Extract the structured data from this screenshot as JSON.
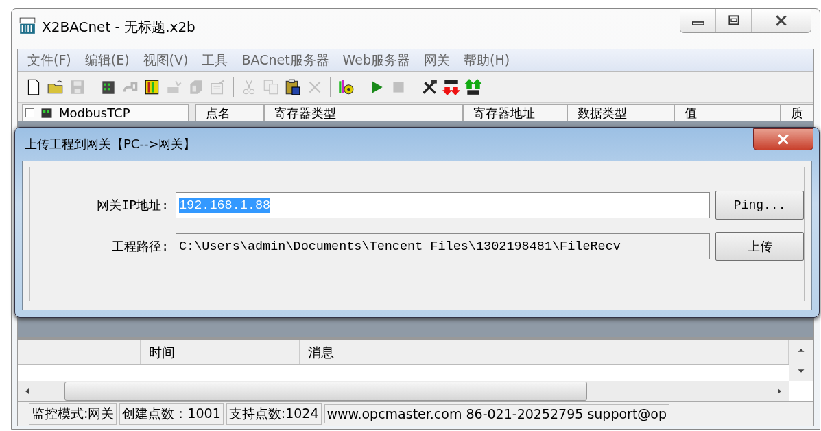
{
  "window": {
    "title": "X2BACnet - 无标题.x2b"
  },
  "menu": [
    "文件(F)",
    "编辑(E)",
    "视图(V)",
    "工具",
    "BACnet服务器",
    "Web服务器",
    "网关",
    "帮助(H)"
  ],
  "toolbar": [
    {
      "kind": "new",
      "disabled": false
    },
    {
      "kind": "open",
      "disabled": false
    },
    {
      "kind": "save",
      "disabled": true
    },
    {
      "kind": "sep"
    },
    {
      "kind": "module",
      "disabled": false
    },
    {
      "kind": "link",
      "disabled": true
    },
    {
      "kind": "rack",
      "disabled": false
    },
    {
      "kind": "spark",
      "disabled": true
    },
    {
      "kind": "cube",
      "disabled": true
    },
    {
      "kind": "form",
      "disabled": true
    },
    {
      "kind": "sep"
    },
    {
      "kind": "cut",
      "disabled": true
    },
    {
      "kind": "copy",
      "disabled": true
    },
    {
      "kind": "paste",
      "disabled": false
    },
    {
      "kind": "delete",
      "disabled": true
    },
    {
      "kind": "sep"
    },
    {
      "kind": "gear",
      "disabled": false
    },
    {
      "kind": "sep"
    },
    {
      "kind": "play",
      "disabled": false
    },
    {
      "kind": "stop",
      "disabled": true
    },
    {
      "kind": "sep"
    },
    {
      "kind": "tools",
      "disabled": false
    },
    {
      "kind": "load",
      "disabled": false
    },
    {
      "kind": "up",
      "disabled": false
    }
  ],
  "tree": {
    "item": "ModbusTCP",
    "checked": false
  },
  "points_table": {
    "columns": [
      "点名",
      "寄存器类型",
      "寄存器地址",
      "数据类型",
      "值",
      "质"
    ]
  },
  "dialog": {
    "title": "上传工程到网关【PC-->网关】",
    "fields": [
      {
        "label": "网关IP地址:",
        "value": "192.168.1.88",
        "selected": true,
        "button": "Ping..."
      },
      {
        "label": "工程路径:",
        "value": "C:\\Users\\admin\\Documents\\Tencent Files\\1302198481\\FileRecv",
        "selected": false,
        "button": "上传"
      }
    ]
  },
  "log_table": {
    "columns": [
      "时间",
      "消息"
    ]
  },
  "status_bar": [
    "监控模式:网关",
    "创建点数：1001",
    "支持点数:1024",
    "www.opcmaster.com 86-021-20252795 support@op"
  ]
}
